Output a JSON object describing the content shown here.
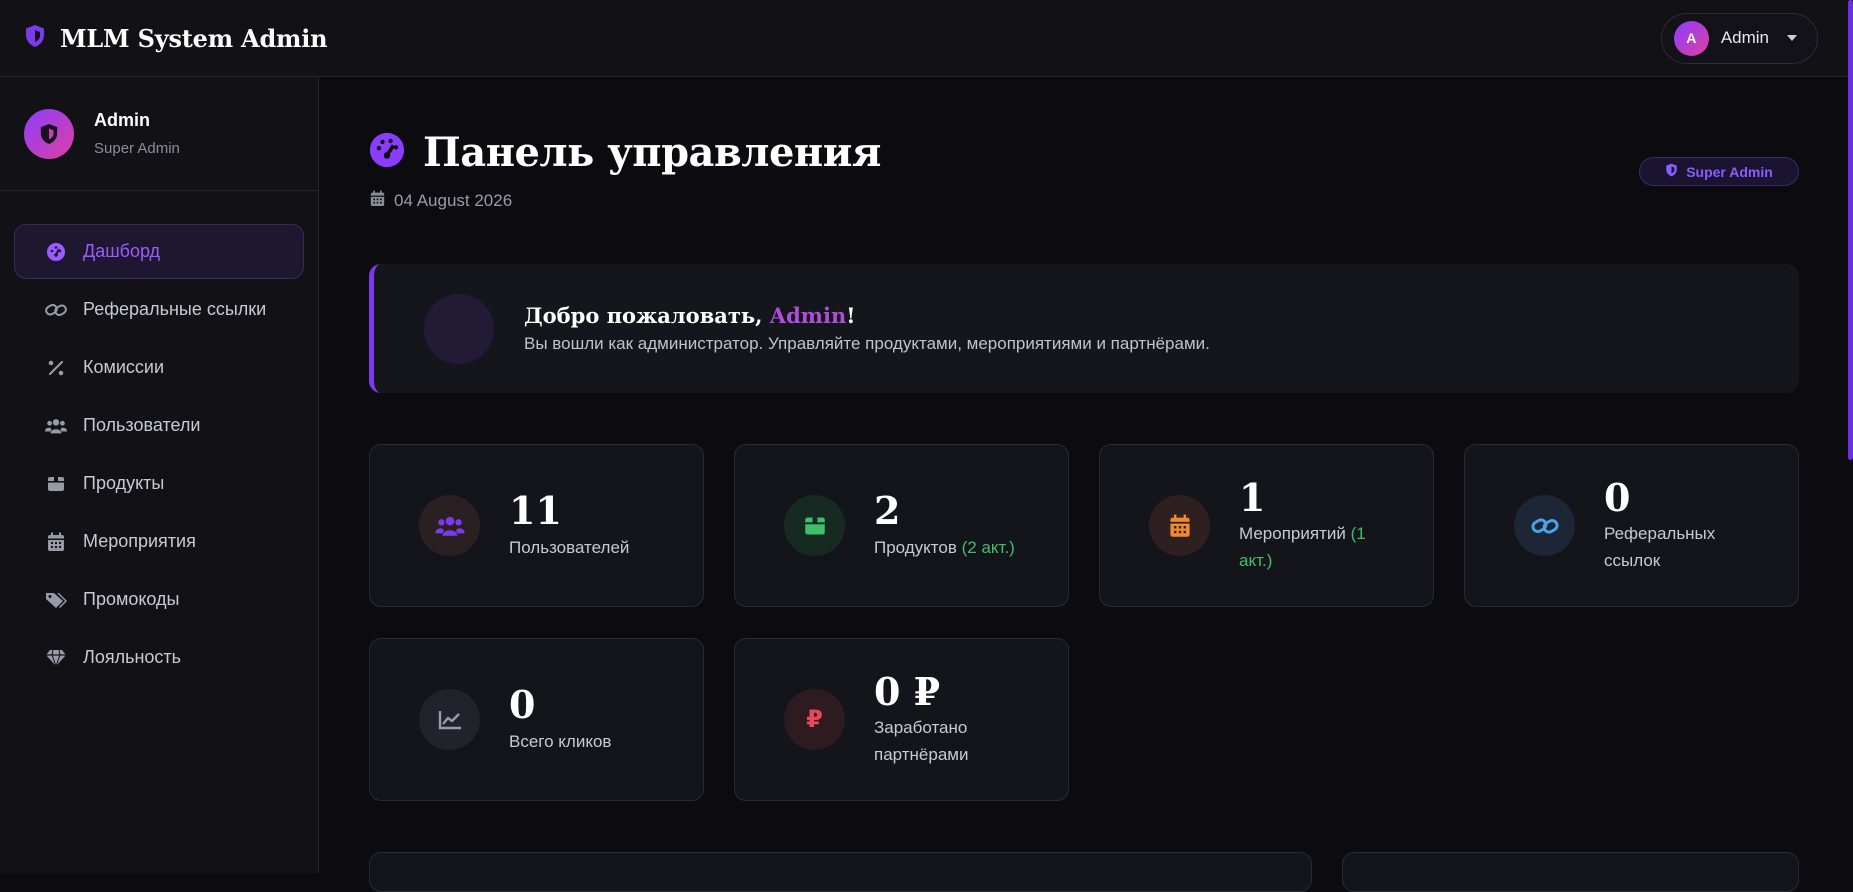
{
  "topbar": {
    "title": "MLM System Admin",
    "user_initial": "A",
    "user_name": "Admin"
  },
  "sidebar": {
    "profile_name": "Admin",
    "profile_role": "Super Admin",
    "items": [
      {
        "label": "Дашборд",
        "icon": "dashboard-icon",
        "active": true
      },
      {
        "label": "Реферальные ссылки",
        "icon": "link-icon",
        "active": false
      },
      {
        "label": "Комиссии",
        "icon": "percent-icon",
        "active": false
      },
      {
        "label": "Пользователи",
        "icon": "users-icon",
        "active": false
      },
      {
        "label": "Продукты",
        "icon": "box-icon",
        "active": false
      },
      {
        "label": "Мероприятия",
        "icon": "calendar-icon",
        "active": false
      },
      {
        "label": "Промокоды",
        "icon": "tags-icon",
        "active": false
      },
      {
        "label": "Лояльность",
        "icon": "gem-icon",
        "active": false
      }
    ]
  },
  "page": {
    "title": "Панель управления",
    "date": "04 August 2026",
    "role_badge": "Super Admin"
  },
  "welcome": {
    "title_prefix": "Добро пожаловать, ",
    "title_name": "Admin",
    "title_suffix": "!",
    "subtitle": "Вы вошли как администратор. Управляйте продуктами, мероприятиями и партнёрами."
  },
  "stats": [
    {
      "value": "11",
      "label": "Пользователей",
      "extra": "",
      "icon": "users-icon",
      "color": "#7c3aed"
    },
    {
      "value": "2",
      "label": "Продуктов",
      "extra": "(2 акт.)",
      "icon": "box-icon",
      "color": "#3fbf6a"
    },
    {
      "value": "1",
      "label": "Мероприятий",
      "extra": "(1 акт.)",
      "icon": "calendar-icon",
      "color": "#f08a2c"
    },
    {
      "value": "0",
      "label": "Реферальных ссылок",
      "extra": "",
      "icon": "link-icon",
      "color": "#4aa3e8"
    },
    {
      "value": "0",
      "label": "Всего кликов",
      "extra": "",
      "icon": "chart-line-icon",
      "color": "#9a9aa6"
    },
    {
      "value": "0 ₽",
      "label": "Заработано партнёрами",
      "extra": "",
      "icon": "ruble-icon",
      "color": "#e8485a"
    }
  ],
  "colors": {
    "accent": "#7c3aed",
    "background": "#0c0c10",
    "panel": "#14141b"
  }
}
